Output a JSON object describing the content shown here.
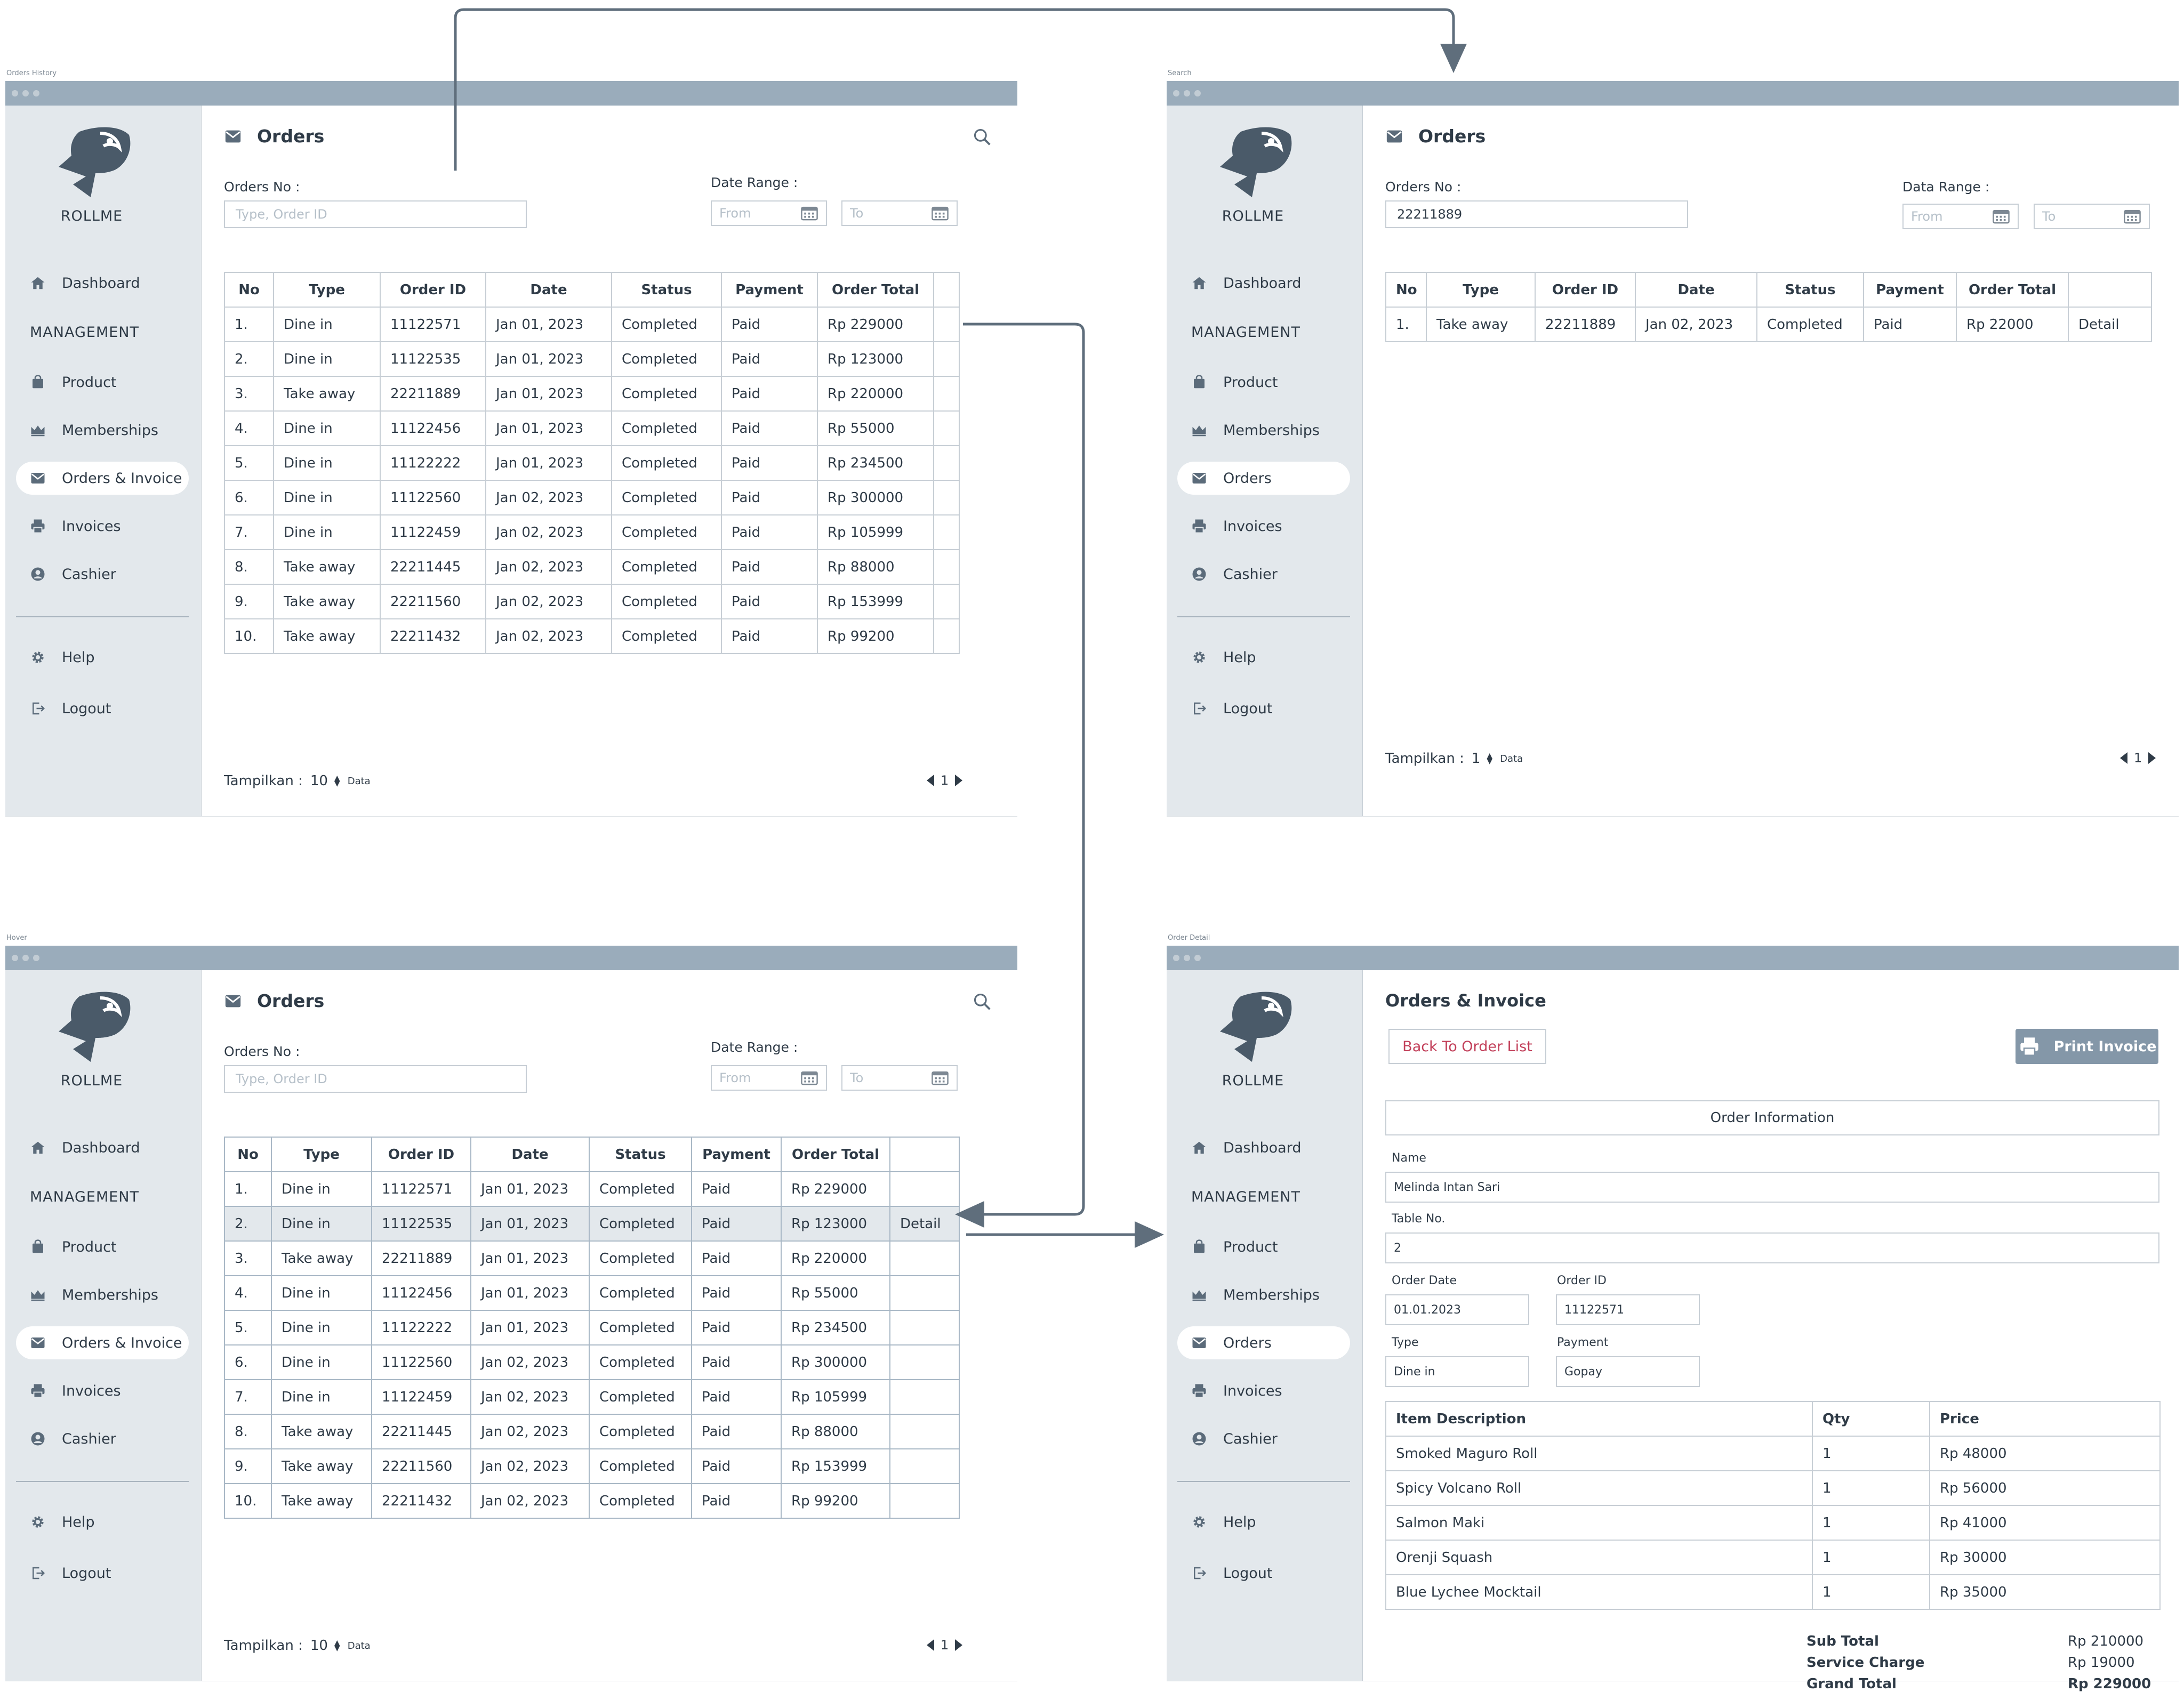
{
  "app": {
    "brand": "ROLLME"
  },
  "frame_labels": {
    "history": "Orders History",
    "search": "Search",
    "hover": "Hover",
    "detail": "Order Detail"
  },
  "nav": {
    "dashboard": "Dashboard",
    "section": "MANAGEMENT",
    "product": "Product",
    "memberships": "Memberships",
    "orders_invoice": "Orders & Invoice",
    "orders": "Orders",
    "invoices": "Invoices",
    "cashier": "Cashier",
    "help": "Help",
    "logout": "Logout"
  },
  "orders_page": {
    "title": "Orders",
    "order_no_label": "Orders No   :",
    "order_no_placeholder": "Type, Order ID",
    "date_range_label": "Date Range :",
    "data_range_label": "Data Range :",
    "from_placeholder": "From",
    "to_placeholder": "To",
    "columns": [
      "No",
      "Type",
      "Order ID",
      "Date",
      "Status",
      "Payment",
      "Order Total",
      ""
    ],
    "rows": [
      [
        "1.",
        "Dine in",
        "11122571",
        "Jan 01, 2023",
        "Completed",
        "Paid",
        "Rp 229000"
      ],
      [
        "2.",
        "Dine in",
        "11122535",
        "Jan 01, 2023",
        "Completed",
        "Paid",
        "Rp 123000"
      ],
      [
        "3.",
        "Take away",
        "22211889",
        "Jan 01, 2023",
        "Completed",
        "Paid",
        "Rp 220000"
      ],
      [
        "4.",
        "Dine in",
        "11122456",
        "Jan 01, 2023",
        "Completed",
        "Paid",
        "Rp 55000"
      ],
      [
        "5.",
        "Dine in",
        "11122222",
        "Jan 01, 2023",
        "Completed",
        "Paid",
        "Rp 234500"
      ],
      [
        "6.",
        "Dine in",
        "11122560",
        "Jan 02, 2023",
        "Completed",
        "Paid",
        "Rp 300000"
      ],
      [
        "7.",
        "Dine in",
        "11122459",
        "Jan 02, 2023",
        "Completed",
        "Paid",
        "Rp 105999"
      ],
      [
        "8.",
        "Take away",
        "22211445",
        "Jan 02, 2023",
        "Completed",
        "Paid",
        "Rp 88000"
      ],
      [
        "9.",
        "Take away",
        "22211560",
        "Jan 02, 2023",
        "Completed",
        "Paid",
        "Rp 153999"
      ],
      [
        "10.",
        "Take away",
        "22211432",
        "Jan 02, 2023",
        "Completed",
        "Paid",
        "Rp 99200"
      ]
    ],
    "detail_label": "Detail",
    "show_label": "Tampilkan   :",
    "show_count": "10",
    "show_unit": "Data",
    "page": "1"
  },
  "search_page": {
    "order_no_value": "22211889",
    "rows": [
      [
        "1.",
        "Take away",
        "22211889",
        "Jan 02, 2023",
        "Completed",
        "Paid",
        "Rp 22000"
      ]
    ],
    "show_count": "1"
  },
  "detail_page": {
    "title": "Orders & Invoice",
    "back_button": "Back To Order List",
    "print_button": "Print Invoice",
    "section_title": "Order Information",
    "name_label": "Name",
    "name_value": "Melinda Intan Sari",
    "table_label": "Table No.",
    "table_value": "2",
    "order_date_label": "Order Date",
    "order_date_value": "01.01.2023",
    "order_id_label": "Order ID",
    "order_id_value": "11122571",
    "type_label": "Type",
    "type_value": "Dine in",
    "payment_label": "Payment",
    "payment_value": "Gopay",
    "item_columns": [
      "Item Description",
      "Qty",
      "Price"
    ],
    "items": [
      [
        "Smoked Maguro Roll",
        "1",
        "Rp 48000"
      ],
      [
        "Spicy Volcano Roll",
        "1",
        "Rp 56000"
      ],
      [
        "Salmon Maki",
        "1",
        "Rp 41000"
      ],
      [
        "Orenji Squash",
        "1",
        "Rp 30000"
      ],
      [
        "Blue Lychee Mocktail",
        "1",
        "Rp 35000"
      ]
    ],
    "subtotal_label": "Sub Total",
    "subtotal_value": "Rp 210000",
    "service_label": "Service Charge",
    "service_value": "Rp 19000",
    "grand_label": "Grand Total",
    "grand_value": "Rp 229000"
  },
  "colors": {
    "titlebar": "#9aacbb",
    "sidebar": "#e3e8ec",
    "text": "#2f3b47",
    "danger": "#c2405a",
    "print_button": "#8497a8",
    "connector": "#5f6e7c"
  }
}
